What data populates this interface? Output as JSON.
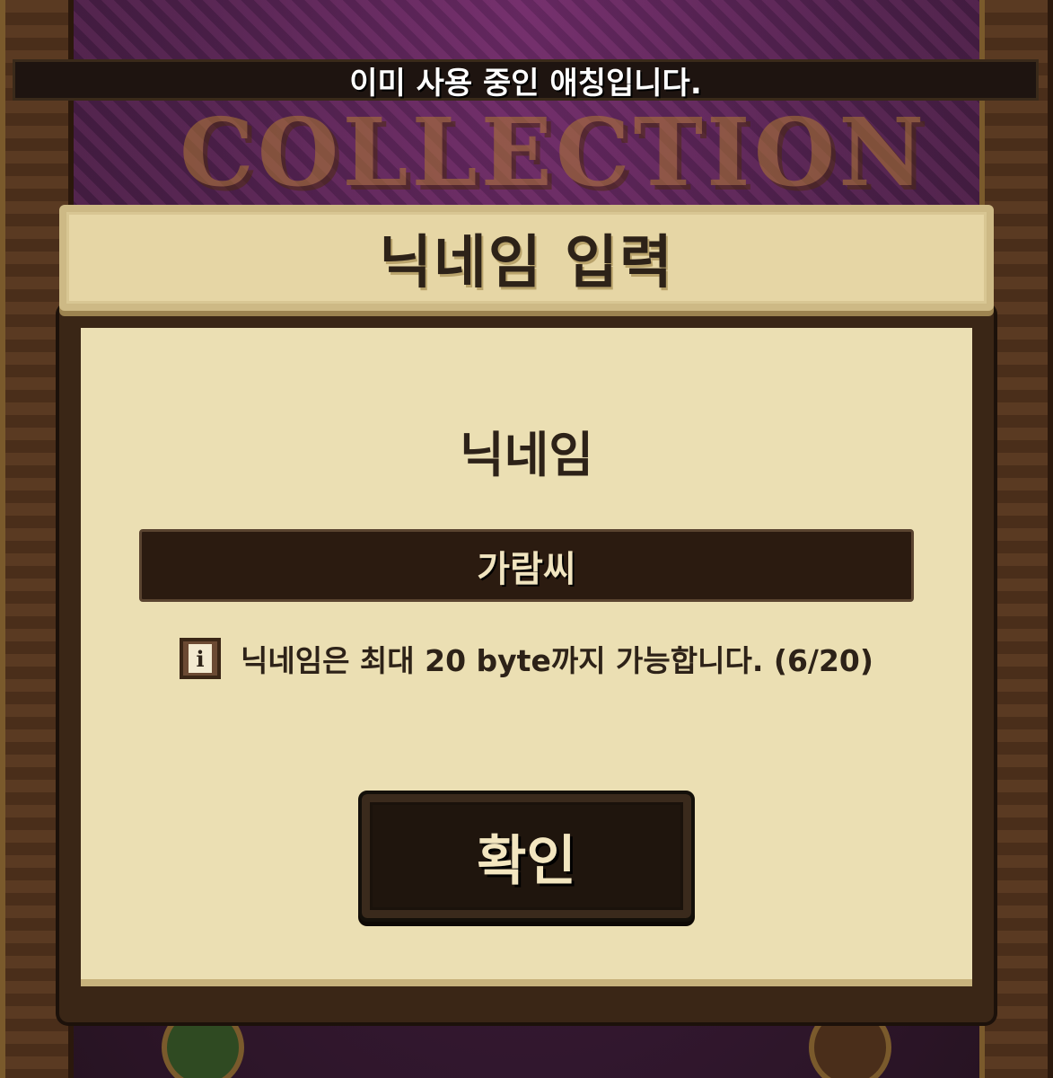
{
  "toast": {
    "message": "이미 사용 중인 애칭입니다."
  },
  "background": {
    "banner_text": "COLLECTION"
  },
  "dialog": {
    "title": "닉네임 입력",
    "field_label": "닉네임",
    "input": {
      "value": "가람씨"
    },
    "info": {
      "icon": "info-icon",
      "icon_glyph": "i",
      "text": "닉네임은 최대 20 byte까지 가능합니다. (6/20)"
    },
    "confirm_button": {
      "label": "확인"
    }
  },
  "colors": {
    "parchment": "#ebdfb3",
    "header_parchment": "#e6d6a5",
    "dark_brown": "#2b1b10",
    "text_dark": "#2d2218",
    "toast_bg": "#1e1410"
  }
}
